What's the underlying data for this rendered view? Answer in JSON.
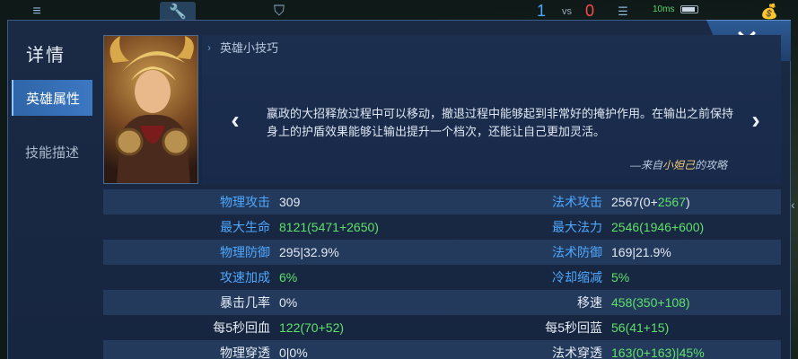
{
  "hud": {
    "score_blue": "1",
    "score_vs": "vs",
    "score_red": "0",
    "ping": "10ms"
  },
  "dialog": {
    "title": "详情",
    "close_label": "✕",
    "tabs": [
      {
        "label": "英雄属性",
        "active": true
      },
      {
        "label": "技能描述",
        "active": false
      }
    ]
  },
  "tip": {
    "header": "英雄小技巧",
    "text": "嬴政的大招释放过程中可以移动，撤退过程中能够起到非常好的掩护作用。在输出之前保持身上的护盾效果能够让输出提升一个档次，还能让自己更加灵活。",
    "source_prefix": "—来自",
    "source_author": "小妲己",
    "source_suffix": "的攻略"
  },
  "stats": [
    {
      "label": "物理攻击",
      "label_color": "blue",
      "value": "309",
      "label2": "法术攻击",
      "label2_color": "blue",
      "value2_base": "2567(0+",
      "value2_bonus": "2567",
      "value2_tail": ")"
    },
    {
      "label": "最大生命",
      "label_color": "blue",
      "value_base": "8121(5471+",
      "value_bonus": "2650",
      "value_tail": ")",
      "label2": "最大法力",
      "label2_color": "blue",
      "value2_base": "2546(1946+",
      "value2_bonus": "600",
      "value2_tail": ")"
    },
    {
      "label": "物理防御",
      "label_color": "blue",
      "value": "295|32.9%",
      "label2": "法术防御",
      "label2_color": "blue",
      "value2_plain": "169|21.9%"
    },
    {
      "label": "攻速加成",
      "label_color": "blue",
      "value_green": "6%",
      "label2": "冷却缩减",
      "label2_color": "blue",
      "value2_green": "5%"
    },
    {
      "label": "暴击几率",
      "label_color": "white",
      "value": "0%",
      "label2": "移速",
      "label2_color": "white",
      "value2_base": "458(350+",
      "value2_bonus": "108",
      "value2_tail": ")"
    },
    {
      "label": "每5秒回血",
      "label_color": "white",
      "value_base": "122(70+",
      "value_bonus": "52",
      "value_tail": ")",
      "label2": "每5秒回蓝",
      "label2_color": "white",
      "value2_base": "56(41+",
      "value2_bonus": "15",
      "value2_tail": ")"
    },
    {
      "label": "物理穿透",
      "label_color": "white",
      "value": "0|0%",
      "label2": "法术穿透",
      "label2_color": "white",
      "value2_base": "163(0+",
      "value2_bonus": "163",
      "value2_tail": ")|45%"
    }
  ],
  "colors": {
    "accent_blue": "#4fa8ff",
    "bonus_green": "#5fe06a",
    "tab_active": "#3c78c2"
  }
}
